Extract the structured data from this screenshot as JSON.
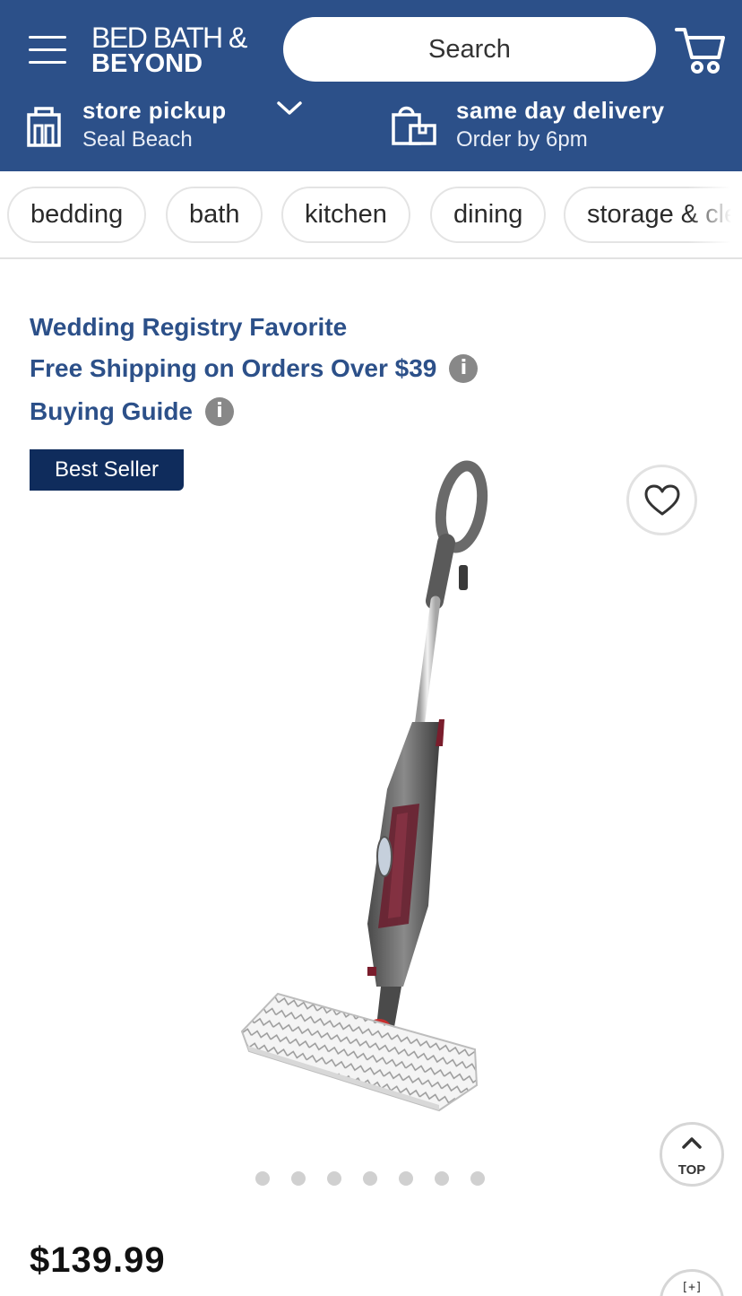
{
  "header": {
    "logo_line1": "BED BATH &",
    "logo_line2": "BEYOND",
    "search_placeholder": "Search",
    "pickup": {
      "title": "store pickup",
      "subtitle": "Seal Beach"
    },
    "delivery": {
      "title": "same day delivery",
      "subtitle": "Order by 6pm"
    },
    "brand_color": "#2c5089"
  },
  "categories": [
    "bedding",
    "bath",
    "kitchen",
    "dining",
    "storage & cle"
  ],
  "promos": {
    "registry": "Wedding Registry Favorite",
    "shipping": "Free Shipping on Orders Over $39",
    "guide": "Buying Guide"
  },
  "product": {
    "badge": "Best Seller",
    "price": "$139.99",
    "image_icon": "steam-mop-image",
    "carousel_count": 7,
    "carousel_active": 0
  },
  "buttons": {
    "top_label": "TOP",
    "expand_label": "[+]"
  }
}
